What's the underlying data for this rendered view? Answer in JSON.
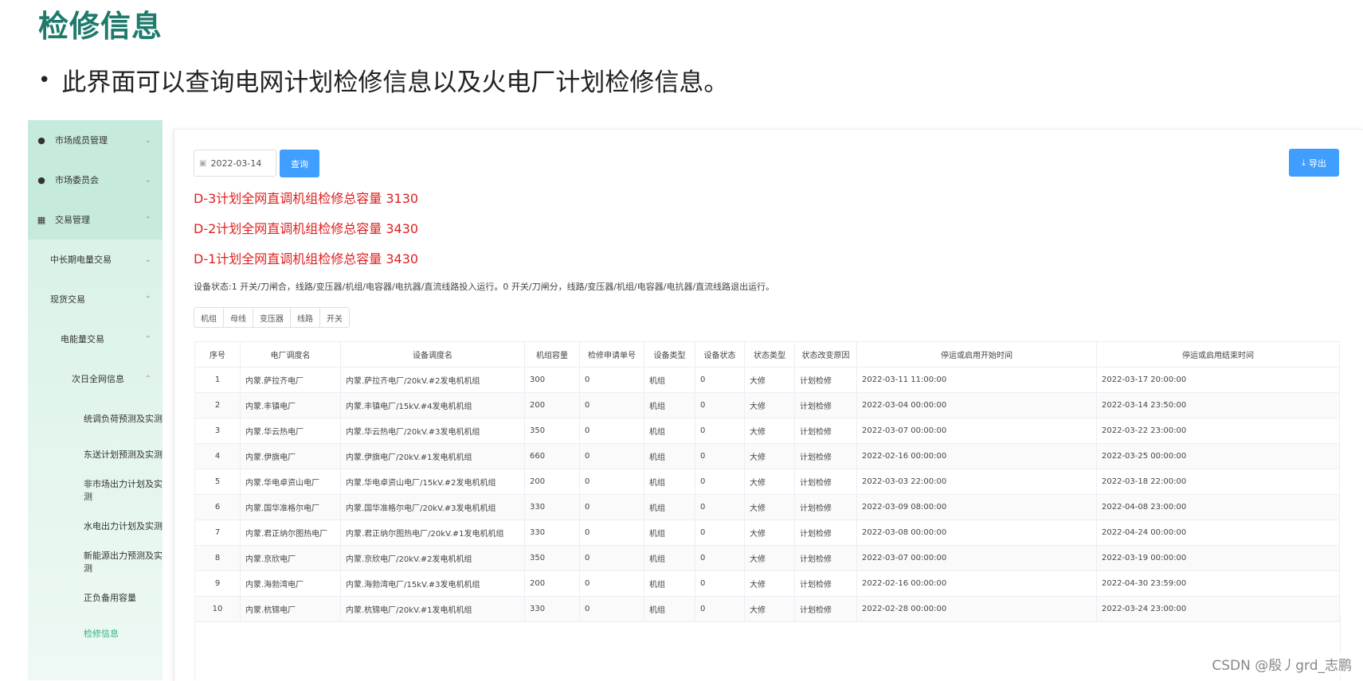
{
  "slide": {
    "title": "检修信息",
    "bullet": "此界面可以查询电网计划检修信息以及火电厂计划检修信息。"
  },
  "sidebar": {
    "items": [
      {
        "label": "市场成员管理",
        "icon": "user-icon",
        "chevron": "chevron-down-icon"
      },
      {
        "label": "市场委员会",
        "icon": "user-icon",
        "chevron": "chevron-down-icon"
      },
      {
        "label": "交易管理",
        "icon": "grid-icon",
        "chevron": "chevron-up-icon"
      },
      {
        "label": "中长期电量交易",
        "chevron": "chevron-down-icon"
      },
      {
        "label": "现货交易",
        "chevron": "chevron-up-icon"
      },
      {
        "label": "电能量交易",
        "chevron": "chevron-up-icon"
      },
      {
        "label": "次日全网信息",
        "chevron": "chevron-up-icon"
      },
      {
        "label": "统调负荷预测及实测"
      },
      {
        "label": "东送计划预测及实测"
      },
      {
        "label": "非市场出力计划及实测"
      },
      {
        "label": "水电出力计划及实测"
      },
      {
        "label": "新能源出力预测及实测"
      },
      {
        "label": "正负备用容量"
      },
      {
        "label": "检修信息",
        "active": true
      }
    ]
  },
  "toolbar": {
    "date_value": "2022-03-14",
    "query_label": "查询",
    "export_label": "导出"
  },
  "capacity": {
    "d3": "D-3计划全网直调机组检修总容量 3130",
    "d2": "D-2计划全网直调机组检修总容量 3430",
    "d1": "D-1计划全网直调机组检修总容量 3430"
  },
  "status_note": "设备状态:1 开关/刀闸合，线路/变压器/机组/电容器/电抗器/直流线路投入运行。0 开关/刀闸分，线路/变压器/机组/电容器/电抗器/直流线路退出运行。",
  "tabs": [
    "机组",
    "母线",
    "变压器",
    "线路",
    "开关"
  ],
  "table": {
    "headers": [
      "序号",
      "电厂调度名",
      "设备调度名",
      "机组容量",
      "检修申请单号",
      "设备类型",
      "设备状态",
      "状态类型",
      "状态改变原因",
      "停运或启用开始时间",
      "停运或启用结束时间"
    ],
    "rows": [
      [
        "1",
        "内蒙.萨拉齐电厂",
        "内蒙.萨拉齐电厂/20kV.#2发电机机组",
        "300",
        "0",
        "机组",
        "0",
        "大修",
        "计划检修",
        "2022-03-11 11:00:00",
        "2022-03-17 20:00:00"
      ],
      [
        "2",
        "内蒙.丰镇电厂",
        "内蒙.丰镇电厂/15kV.#4发电机机组",
        "200",
        "0",
        "机组",
        "0",
        "大修",
        "计划检修",
        "2022-03-04 00:00:00",
        "2022-03-14 23:50:00"
      ],
      [
        "3",
        "内蒙.华云热电厂",
        "内蒙.华云热电厂/20kV.#3发电机机组",
        "350",
        "0",
        "机组",
        "0",
        "大修",
        "计划检修",
        "2022-03-07 00:00:00",
        "2022-03-22 23:00:00"
      ],
      [
        "4",
        "内蒙.伊旗电厂",
        "内蒙.伊旗电厂/20kV.#1发电机机组",
        "660",
        "0",
        "机组",
        "0",
        "大修",
        "计划检修",
        "2022-02-16 00:00:00",
        "2022-03-25 00:00:00"
      ],
      [
        "5",
        "内蒙.华电卓资山电厂",
        "内蒙.华电卓资山电厂/15kV.#2发电机机组",
        "200",
        "0",
        "机组",
        "0",
        "大修",
        "计划检修",
        "2022-03-03 22:00:00",
        "2022-03-18 22:00:00"
      ],
      [
        "6",
        "内蒙.国华准格尔电厂",
        "内蒙.国华准格尔电厂/20kV.#3发电机机组",
        "330",
        "0",
        "机组",
        "0",
        "大修",
        "计划检修",
        "2022-03-09 08:00:00",
        "2022-04-08 23:00:00"
      ],
      [
        "7",
        "内蒙.君正纳尔图热电厂",
        "内蒙.君正纳尔图热电厂/20kV.#1发电机机组",
        "330",
        "0",
        "机组",
        "0",
        "大修",
        "计划检修",
        "2022-03-08 00:00:00",
        "2022-04-24 00:00:00"
      ],
      [
        "8",
        "内蒙.京欣电厂",
        "内蒙.京欣电厂/20kV.#2发电机机组",
        "350",
        "0",
        "机组",
        "0",
        "大修",
        "计划检修",
        "2022-03-07 00:00:00",
        "2022-03-19 00:00:00"
      ],
      [
        "9",
        "内蒙.海勃湾电厂",
        "内蒙.海勃湾电厂/15kV.#3发电机机组",
        "200",
        "0",
        "机组",
        "0",
        "大修",
        "计划检修",
        "2022-02-16 00:00:00",
        "2022-04-30 23:59:00"
      ],
      [
        "10",
        "内蒙.杭锦电厂",
        "内蒙.杭锦电厂/20kV.#1发电机机组",
        "330",
        "0",
        "机组",
        "0",
        "大修",
        "计划检修",
        "2022-02-28 00:00:00",
        "2022-03-24 23:00:00"
      ]
    ]
  },
  "watermark": "CSDN @殷丿grd_志鹏"
}
